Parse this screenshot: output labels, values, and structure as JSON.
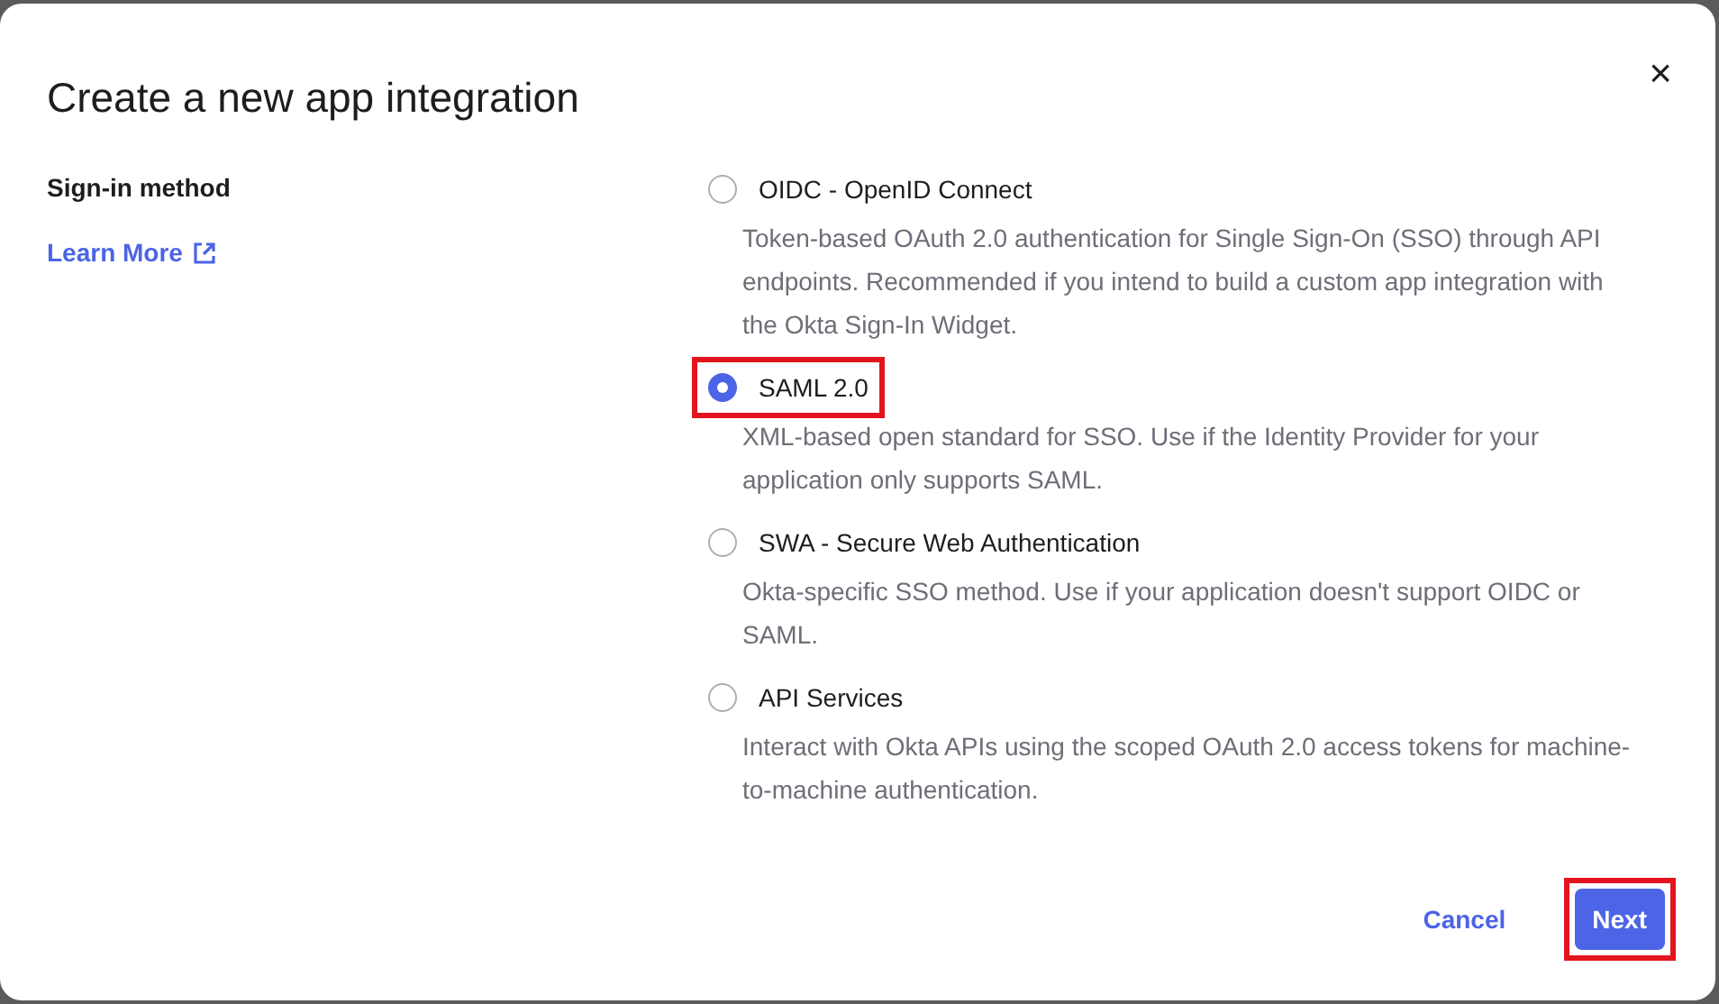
{
  "dialog": {
    "title": "Create a new app integration",
    "close_label": "×"
  },
  "section": {
    "label": "Sign-in method",
    "link": "Learn More"
  },
  "options": [
    {
      "label": "OIDC - OpenID Connect",
      "description": "Token-based OAuth 2.0 authentication for Single Sign-On (SSO) through API endpoints. Recommended if you intend to build a custom app integration with the Okta Sign-In Widget.",
      "selected": false,
      "highlighted": false
    },
    {
      "label": "SAML 2.0",
      "description": "XML-based open standard for SSO. Use if the Identity Provider for your application only supports SAML.",
      "selected": true,
      "highlighted": true
    },
    {
      "label": "SWA - Secure Web Authentication",
      "description": "Okta-specific SSO method. Use if your application doesn't support OIDC or SAML.",
      "selected": false,
      "highlighted": false
    },
    {
      "label": "API Services",
      "description": "Interact with Okta APIs using the scoped OAuth 2.0 access tokens for machine-to-machine authentication.",
      "selected": false,
      "highlighted": false
    }
  ],
  "buttons": [
    {
      "label": "Cancel",
      "kind": "secondary",
      "highlighted": false
    },
    {
      "label": "Next",
      "kind": "primary",
      "highlighted": true
    }
  ]
}
